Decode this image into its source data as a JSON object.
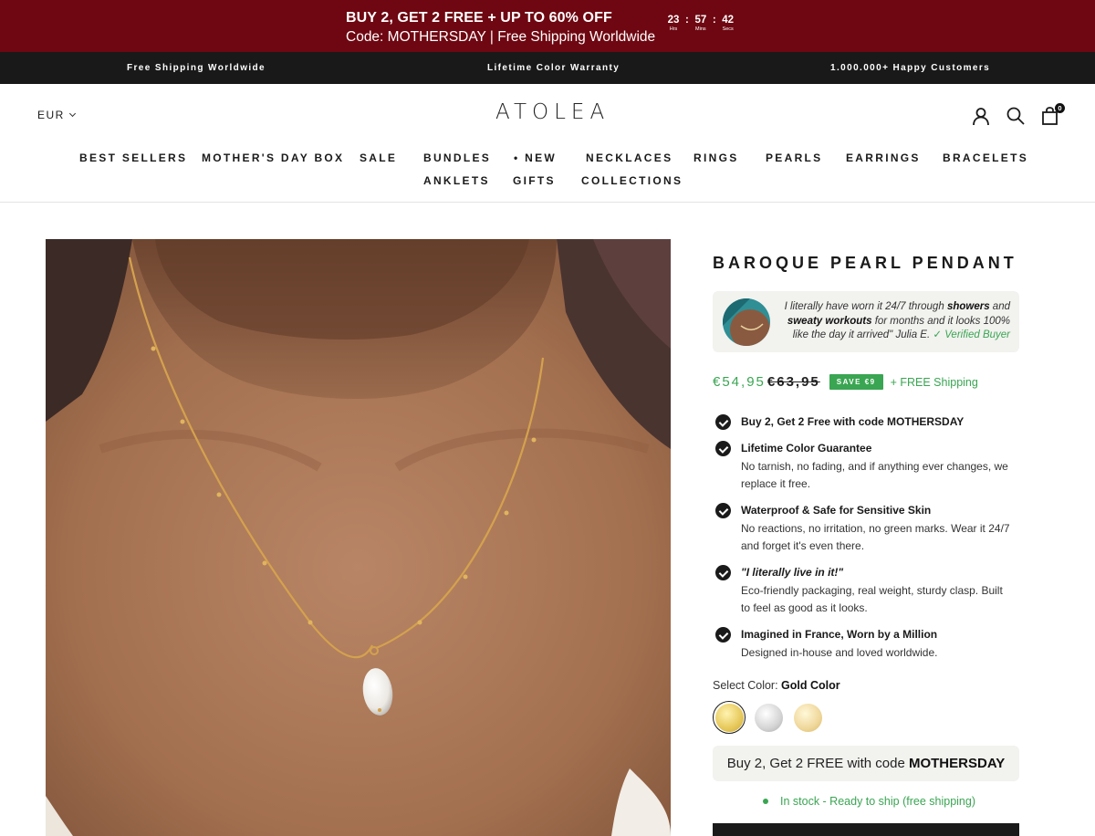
{
  "promo": {
    "headline": "BUY 2, GET 2 FREE + UP TO 60% OFF",
    "subline": "Code: MOTHERSDAY | Free Shipping Worldwide",
    "countdown": {
      "hours": "23",
      "hours_label": "Hrs",
      "minutes": "57",
      "minutes_label": "Mins",
      "seconds": "42",
      "seconds_label": "Secs",
      "separator": ":"
    }
  },
  "benefits": {
    "left": "Free Shipping Worldwide",
    "center": "Lifetime Color Warranty",
    "right": "1.000.000+ Happy Customers"
  },
  "header": {
    "currency": "EUR",
    "logo": "ATOLEA",
    "cart_count": "0",
    "icons": [
      "account-icon",
      "search-icon",
      "cart-icon"
    ]
  },
  "nav": {
    "row1": [
      "BEST SELLERS",
      "MOTHER'S DAY BOX",
      "SALE",
      "BUNDLES",
      "• NEW",
      "NECKLACES",
      "RINGS",
      "PEARLS",
      "EARRINGS",
      "BRACELETS"
    ],
    "row2": [
      "ANKLETS",
      "GIFTS",
      "COLLECTIONS"
    ]
  },
  "product": {
    "title": "BAROQUE PEARL PENDANT",
    "review": {
      "part1": "I literally have worn it 24/7 through ",
      "bold1": "showers",
      "part2": " and ",
      "bold2": "sweaty workouts",
      "part3": " for months and it looks 100% like the day it arrived\" Julia E. ",
      "verified": "✓ Verified Buyer"
    },
    "price": "€54,95",
    "price_old": "€63,95",
    "save_badge": "SAVE €9",
    "free_shipping": "+ FREE Shipping",
    "features": [
      {
        "title": "Buy 2, Get 2 Free with code MOTHERSDAY",
        "body": ""
      },
      {
        "title": "Lifetime Color Guarantee",
        "body": "No tarnish, no fading, and if anything ever changes, we replace it free."
      },
      {
        "title": "Waterproof & Safe for Sensitive Skin",
        "body": "No reactions, no irritation, no green marks. Wear it 24/7 and forget it's even there."
      },
      {
        "title": "\"I literally live in it!\"",
        "body": "Eco-friendly packaging, real weight, sturdy clasp. Built to feel as good as it looks."
      },
      {
        "title": "Imagined in France, Worn by a Million",
        "body": "Designed in-house and loved worldwide."
      }
    ],
    "color_label": "Select Color: ",
    "color_selected": "Gold Color",
    "swatches": [
      {
        "name": "gold",
        "color": "#e8cf6a"
      },
      {
        "name": "silver",
        "color": "#d8d8d8"
      },
      {
        "name": "light-gold",
        "color": "#f0dba0"
      }
    ],
    "promo_box_text": "Buy 2, Get 2 FREE with code ",
    "promo_box_code": "MOTHERSDAY",
    "stock_text": "In stock - Ready to ship (free shipping)"
  },
  "colors": {
    "promo_bg": "#6e0711",
    "benefits_bg": "#191919",
    "accent_green": "#3aa552"
  }
}
